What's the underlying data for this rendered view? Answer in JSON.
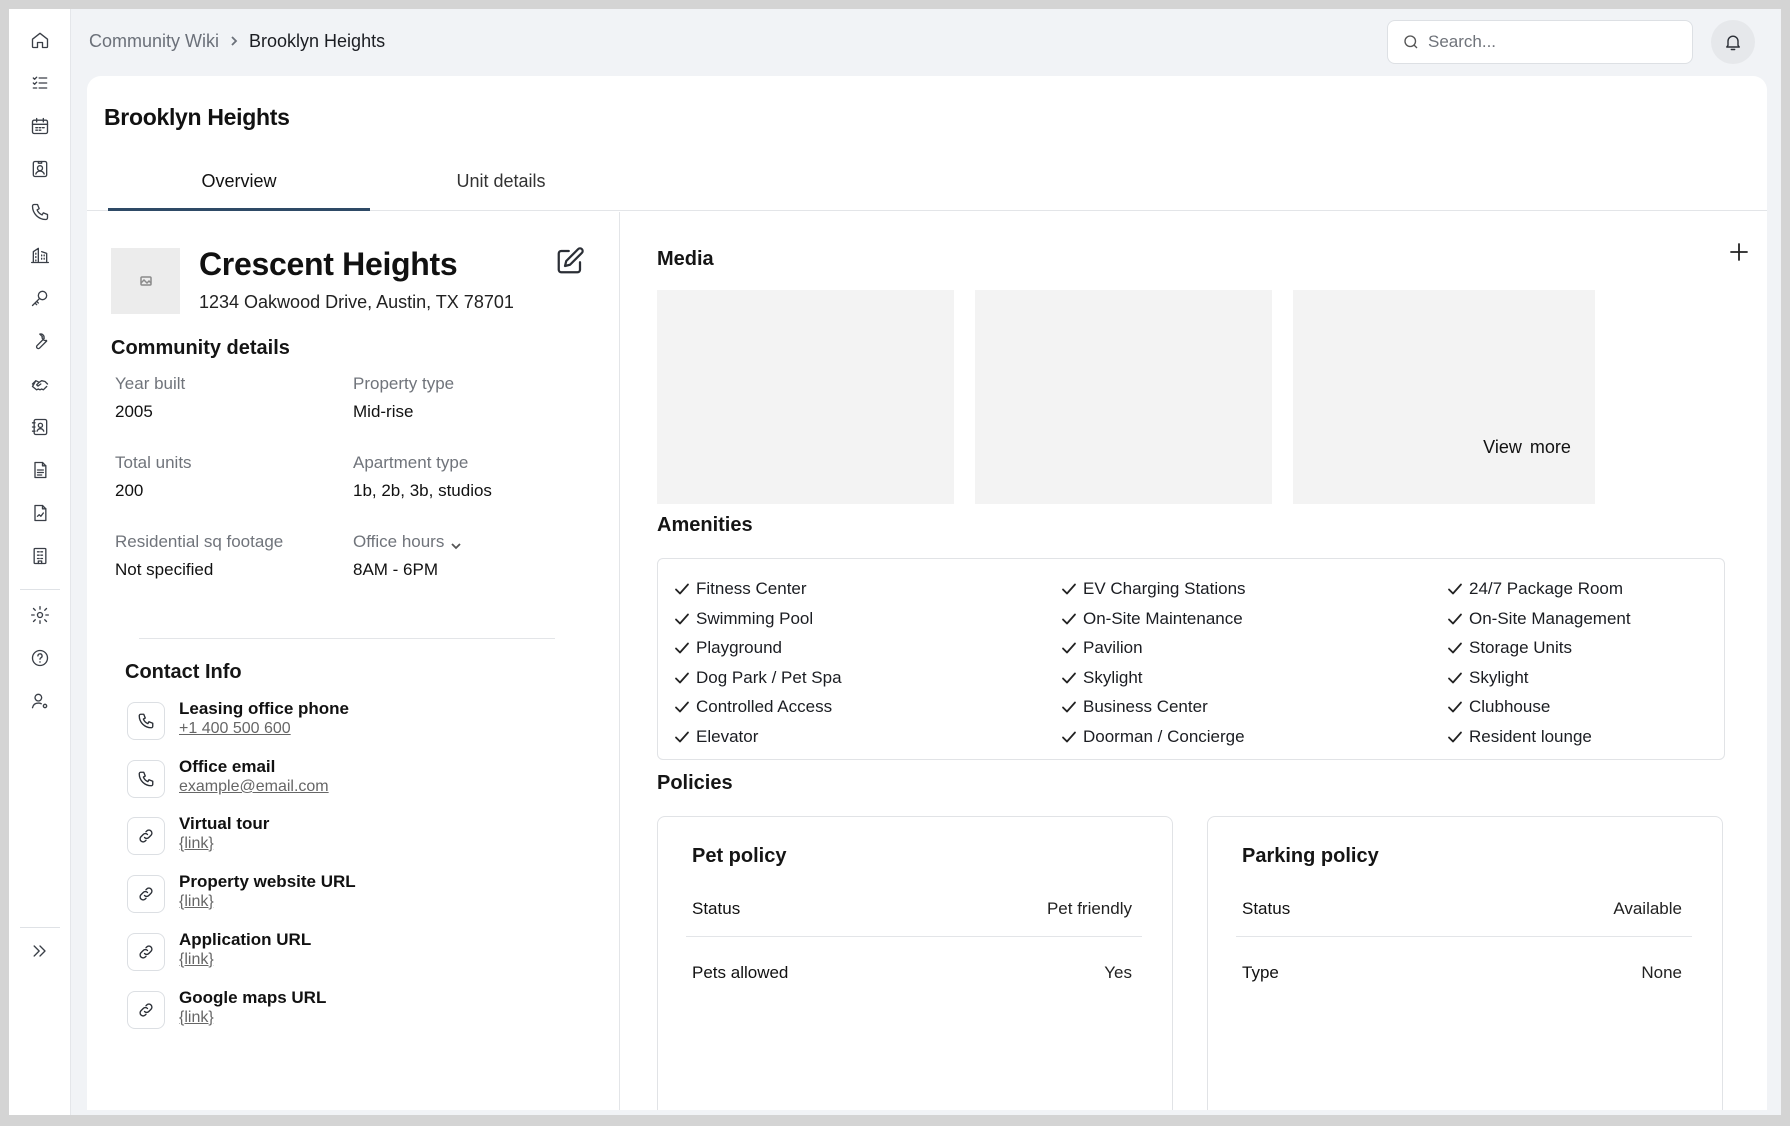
{
  "breadcrumb": {
    "root": "Community Wiki",
    "current": "Brooklyn Heights"
  },
  "search": {
    "placeholder": "Search..."
  },
  "page": {
    "title": "Brooklyn Heights",
    "tabs": [
      {
        "label": "Overview"
      },
      {
        "label": "Unit details"
      }
    ]
  },
  "property": {
    "name": "Crescent Heights",
    "address": "1234 Oakwood Drive, Austin, TX 78701"
  },
  "community_details": {
    "heading": "Community details",
    "fields": [
      {
        "label": "Year built",
        "value": "2005"
      },
      {
        "label": "Property type",
        "value": "Mid-rise"
      },
      {
        "label": "Total units",
        "value": "200"
      },
      {
        "label": "Apartment type",
        "value": "1b, 2b, 3b, studios"
      },
      {
        "label": "Residential sq footage",
        "value": "Not specified"
      },
      {
        "label": "Office hours",
        "value": "8AM - 6PM"
      }
    ]
  },
  "contact": {
    "heading": "Contact Info",
    "items": [
      {
        "label": "Leasing office phone",
        "value": "+1 400 500 600",
        "icon": "phone-icon"
      },
      {
        "label": "Office email",
        "value": "example@email.com",
        "icon": "phone-icon"
      },
      {
        "label": "Virtual tour",
        "value": "{link}",
        "icon": "link-icon"
      },
      {
        "label": "Property website URL",
        "value": "{link}",
        "icon": "link-icon"
      },
      {
        "label": "Application URL",
        "value": "{link}",
        "icon": "link-icon"
      },
      {
        "label": "Google maps URL",
        "value": "{link}",
        "icon": "link-icon"
      }
    ]
  },
  "media": {
    "heading": "Media",
    "view_more": "View  more"
  },
  "amenities": {
    "heading": "Amenities",
    "columns": [
      [
        "Fitness Center",
        "Swimming Pool",
        "Playground",
        "Dog Park / Pet Spa",
        "Controlled Access",
        "Elevator"
      ],
      [
        "EV Charging Stations",
        "On-Site Maintenance",
        "Pavilion",
        "Skylight",
        "Business Center",
        "Doorman / Concierge"
      ],
      [
        "24/7 Package Room",
        "On-Site Management",
        "Storage Units",
        "Skylight",
        "Clubhouse",
        "Resident lounge"
      ]
    ]
  },
  "policies": {
    "heading": "Policies",
    "pet": {
      "title": "Pet policy",
      "rows": [
        {
          "key": "Status",
          "value": "Pet friendly"
        },
        {
          "key": "Pets allowed",
          "value": "Yes"
        }
      ]
    },
    "parking": {
      "title": "Parking policy",
      "rows": [
        {
          "key": "Status",
          "value": "Available"
        },
        {
          "key": "Type",
          "value": "None"
        }
      ]
    }
  },
  "sidebar_icons": [
    "home-icon",
    "checklist-icon",
    "calendar-icon",
    "contact-card-icon",
    "phone-icon",
    "building-icon",
    "key-icon",
    "wrench-icon",
    "handshake-icon",
    "address-book-icon",
    "document-icon",
    "report-icon",
    "office-building-icon",
    "settings-icon",
    "help-icon",
    "user-settings-icon",
    "expand-icon"
  ]
}
